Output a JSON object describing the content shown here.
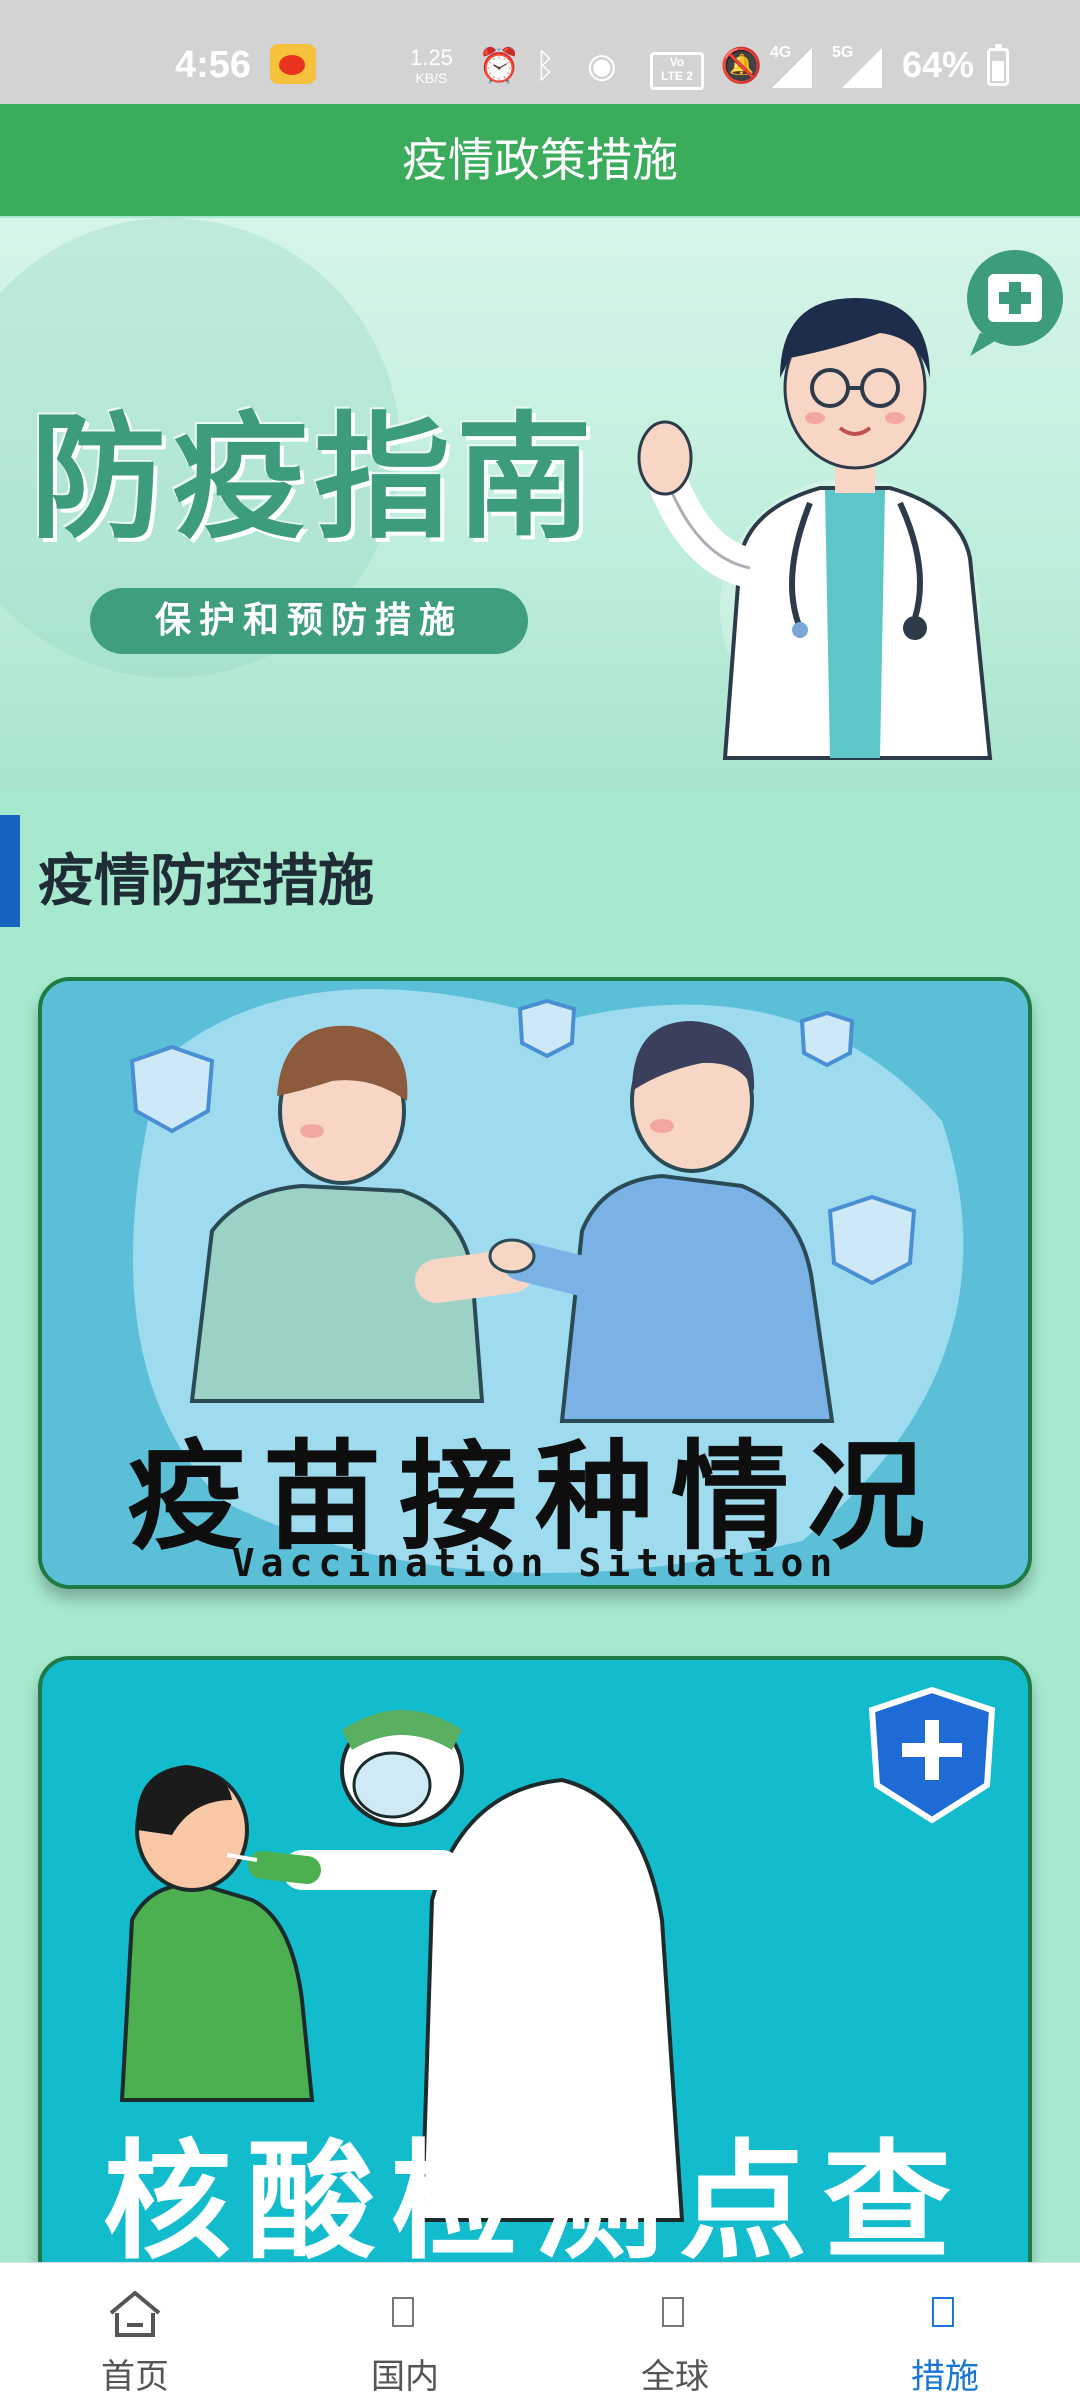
{
  "status_bar": {
    "time": "4:56",
    "speed_value": "1.25",
    "speed_unit": "KB/S",
    "volte_top": "Vo",
    "volte_bottom": "LTE 2",
    "net1": "4G",
    "net2": "5G",
    "battery": "64%"
  },
  "header": {
    "title": "疫情政策措施"
  },
  "banner": {
    "title": "防疫指南",
    "subtitle": "保护和预防措施"
  },
  "section": {
    "title": "疫情防控措施"
  },
  "cards": [
    {
      "title": "疫苗接种情况",
      "subtitle": "Vaccination Situation"
    },
    {
      "title": "核酸检测点查询"
    }
  ],
  "bottom_nav": {
    "items": [
      {
        "label": "首页",
        "icon": "home-icon"
      },
      {
        "label": "国内",
        "icon": "missing-glyph-icon"
      },
      {
        "label": "全球",
        "icon": "missing-glyph-icon"
      },
      {
        "label": "措施",
        "icon": "missing-glyph-icon"
      }
    ],
    "active_index": 3
  },
  "colors": {
    "header": "#3aac5c",
    "page_bg": "#a6e9cf",
    "section_bar": "#1565c0",
    "nav_active": "#1976d2"
  }
}
